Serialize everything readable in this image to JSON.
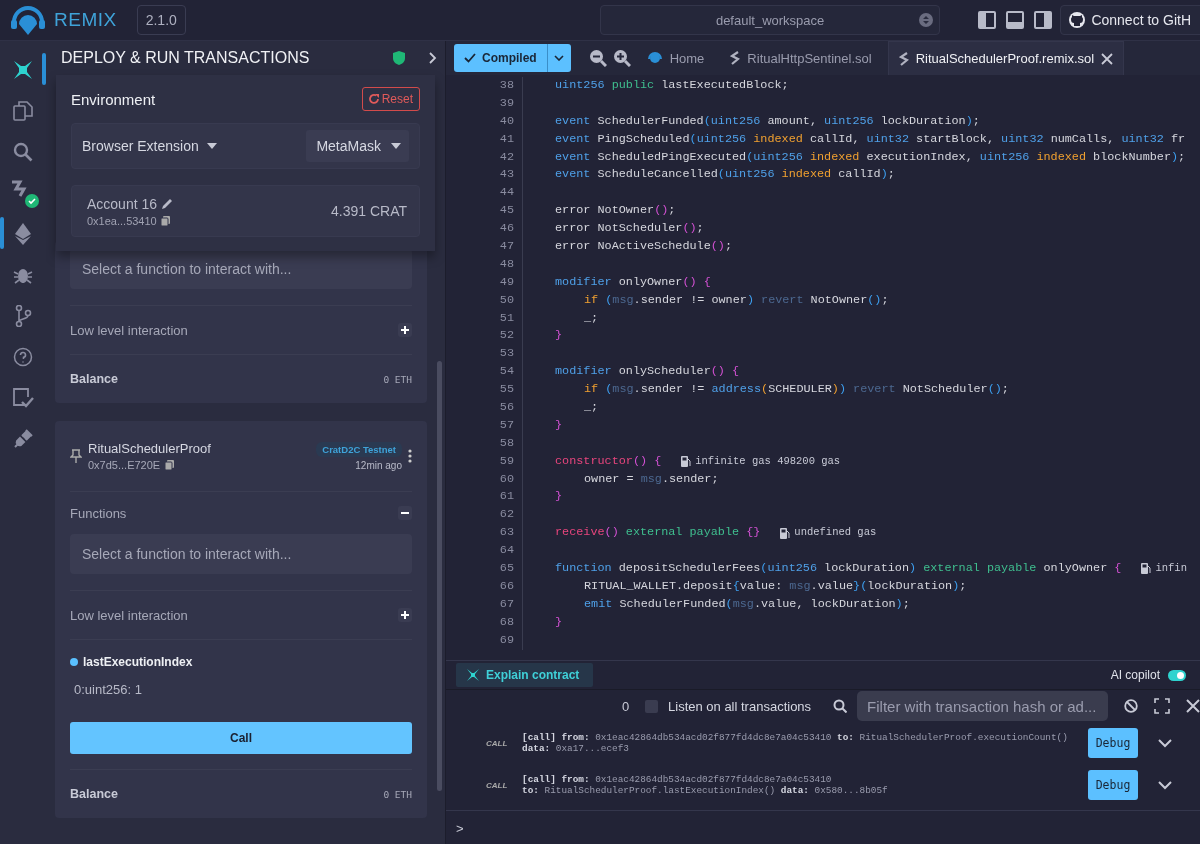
{
  "topbar": {
    "brand": "REMIX",
    "version": "2.1.0",
    "workspace": "default_workspace",
    "github_button": "Connect to GitH"
  },
  "icon_rail": [
    {
      "kind": "ai",
      "highlighted": true,
      "selected": false,
      "verified": false
    },
    {
      "kind": "files",
      "highlighted": false,
      "selected": false,
      "verified": false
    },
    {
      "kind": "search",
      "highlighted": false,
      "selected": false,
      "verified": false
    },
    {
      "kind": "compiler",
      "highlighted": false,
      "selected": false,
      "verified": true
    },
    {
      "kind": "deploy",
      "highlighted": false,
      "selected": true,
      "verified": false
    },
    {
      "kind": "debug",
      "highlighted": false,
      "selected": false,
      "verified": false
    },
    {
      "kind": "git",
      "highlighted": false,
      "selected": false,
      "verified": false
    },
    {
      "kind": "help",
      "highlighted": false,
      "selected": false,
      "verified": false
    },
    {
      "kind": "checklist",
      "highlighted": false,
      "selected": false,
      "verified": false
    },
    {
      "kind": "plugin",
      "highlighted": false,
      "selected": false,
      "verified": false
    }
  ],
  "panel": {
    "title": "DEPLOY & RUN TRANSACTIONS",
    "environment": {
      "label": "Environment",
      "reset": "Reset",
      "provider": "Browser Extension",
      "wallet": "MetaMask",
      "account": "Account 16",
      "address": "0x1ea...53410",
      "balance": "4.391 CRAT"
    },
    "contracts": [
      {
        "functions_select": "Select a function to interact with...",
        "low_level": "Low level interaction",
        "balance_label": "Balance",
        "balance": "0 ETH"
      },
      {
        "name": "RitualSchedulerProof",
        "address": "0x7d5...E720E",
        "network": "CratD2C Testnet",
        "age": "12min ago",
        "functions_label": "Functions",
        "expanded": true,
        "functions_select": "Select a function to interact with...",
        "low_level": "Low level interaction",
        "result": {
          "function": "lastExecutionIndex",
          "value": "0:uint256: 1",
          "button": "Call"
        },
        "balance_label": "Balance",
        "balance": "0 ETH"
      }
    ]
  },
  "editor": {
    "compile_button": "Compiled",
    "tabs": [
      {
        "label": "Home",
        "kind": "home",
        "selected": false
      },
      {
        "label": "RitualHttpSentinel.sol",
        "kind": "file",
        "selected": false
      },
      {
        "label": "RitualSchedulerProof.remix.sol",
        "kind": "file",
        "selected": true
      }
    ],
    "lines": [
      {
        "number": "38",
        "indented": false,
        "tokens": [
          {
            "text": "uint256",
            "kind": "kw"
          },
          {
            "text": " public",
            "kind": "mod"
          },
          {
            "text": " lastExecutedBlock;",
            "kind": "plain"
          }
        ]
      },
      {
        "number": "39"
      },
      {
        "number": "40",
        "indented": false,
        "tokens": [
          {
            "text": "event",
            "kind": "kw"
          },
          {
            "text": " SchedulerFunded",
            "kind": "plain"
          },
          {
            "text": "(",
            "kind": "paren"
          },
          {
            "text": "uint256",
            "kind": "kw"
          },
          {
            "text": " amount, ",
            "kind": "plain"
          },
          {
            "text": "uint256",
            "kind": "kw"
          },
          {
            "text": " lockDuration",
            "kind": "plain"
          },
          {
            "text": ")",
            "kind": "paren"
          },
          {
            "text": ";",
            "kind": "plain"
          }
        ]
      },
      {
        "number": "41",
        "indented": false,
        "tokens": [
          {
            "text": "event",
            "kind": "kw"
          },
          {
            "text": " PingScheduled",
            "kind": "plain"
          },
          {
            "text": "(",
            "kind": "paren"
          },
          {
            "text": "uint256",
            "kind": "kw"
          },
          {
            "text": " indexed",
            "kind": "idx"
          },
          {
            "text": " callId, ",
            "kind": "plain"
          },
          {
            "text": "uint32",
            "kind": "kw"
          },
          {
            "text": " startBlock, ",
            "kind": "plain"
          },
          {
            "text": "uint32",
            "kind": "kw"
          },
          {
            "text": " numCalls, ",
            "kind": "plain"
          },
          {
            "text": "uint32",
            "kind": "kw"
          },
          {
            "text": " fr",
            "kind": "plain"
          }
        ]
      },
      {
        "number": "42",
        "indented": false,
        "tokens": [
          {
            "text": "event",
            "kind": "kw"
          },
          {
            "text": " ScheduledPingExecuted",
            "kind": "plain"
          },
          {
            "text": "(",
            "kind": "paren"
          },
          {
            "text": "uint256",
            "kind": "kw"
          },
          {
            "text": " indexed",
            "kind": "idx"
          },
          {
            "text": " executionIndex, ",
            "kind": "plain"
          },
          {
            "text": "uint256",
            "kind": "kw"
          },
          {
            "text": " indexed",
            "kind": "idx"
          },
          {
            "text": " blockNumber",
            "kind": "plain"
          },
          {
            "text": ")",
            "kind": "paren"
          },
          {
            "text": ";",
            "kind": "plain"
          }
        ]
      },
      {
        "number": "43",
        "indented": false,
        "tokens": [
          {
            "text": "event",
            "kind": "kw"
          },
          {
            "text": " ScheduleCancelled",
            "kind": "plain"
          },
          {
            "text": "(",
            "kind": "paren"
          },
          {
            "text": "uint256",
            "kind": "kw"
          },
          {
            "text": " indexed",
            "kind": "idx"
          },
          {
            "text": " callId",
            "kind": "plain"
          },
          {
            "text": ")",
            "kind": "paren"
          },
          {
            "text": ";",
            "kind": "plain"
          }
        ]
      },
      {
        "number": "44"
      },
      {
        "number": "45",
        "indented": false,
        "tokens": [
          {
            "text": "error NotOwner",
            "kind": "plain"
          },
          {
            "text": "()",
            "kind": "brace"
          },
          {
            "text": ";",
            "kind": "plain"
          }
        ]
      },
      {
        "number": "46",
        "indented": false,
        "tokens": [
          {
            "text": "error NotScheduler",
            "kind": "plain"
          },
          {
            "text": "()",
            "kind": "brace"
          },
          {
            "text": ";",
            "kind": "plain"
          }
        ]
      },
      {
        "number": "47",
        "indented": false,
        "tokens": [
          {
            "text": "error NoActiveSchedule",
            "kind": "plain"
          },
          {
            "text": "()",
            "kind": "brace"
          },
          {
            "text": ";",
            "kind": "plain"
          }
        ]
      },
      {
        "number": "48"
      },
      {
        "number": "49",
        "indented": false,
        "tokens": [
          {
            "text": "modifier",
            "kind": "kw"
          },
          {
            "text": " onlyOwner",
            "kind": "plain"
          },
          {
            "text": "()",
            "kind": "brace"
          },
          {
            "text": " {",
            "kind": "brace"
          }
        ]
      },
      {
        "number": "50",
        "indented": true,
        "tokens": [
          {
            "text": "if",
            "kind": "idx"
          },
          {
            "text": " (",
            "kind": "paren"
          },
          {
            "text": "msg",
            "kind": "dim"
          },
          {
            "text": ".sender != owner",
            "kind": "plain"
          },
          {
            "text": ")",
            "kind": "paren"
          },
          {
            "text": " revert",
            "kind": "dim"
          },
          {
            "text": " NotOwner",
            "kind": "plain"
          },
          {
            "text": "()",
            "kind": "paren"
          },
          {
            "text": ";",
            "kind": "plain"
          }
        ]
      },
      {
        "number": "51",
        "indented": true,
        "tokens": [
          {
            "text": "_;",
            "kind": "plain"
          }
        ]
      },
      {
        "number": "52",
        "indented": false,
        "tokens": [
          {
            "text": "}",
            "kind": "brace"
          }
        ]
      },
      {
        "number": "53"
      },
      {
        "number": "54",
        "indented": false,
        "tokens": [
          {
            "text": "modifier",
            "kind": "kw"
          },
          {
            "text": " onlyScheduler",
            "kind": "plain"
          },
          {
            "text": "()",
            "kind": "brace"
          },
          {
            "text": " {",
            "kind": "brace"
          }
        ]
      },
      {
        "number": "55",
        "indented": true,
        "tokens": [
          {
            "text": "if",
            "kind": "idx"
          },
          {
            "text": " (",
            "kind": "paren"
          },
          {
            "text": "msg",
            "kind": "dim"
          },
          {
            "text": ".sender != ",
            "kind": "plain"
          },
          {
            "text": "address",
            "kind": "kw"
          },
          {
            "text": "(",
            "kind": "idx"
          },
          {
            "text": "SCHEDULER",
            "kind": "plain"
          },
          {
            "text": ")",
            "kind": "idx"
          },
          {
            "text": ")",
            "kind": "paren"
          },
          {
            "text": " revert",
            "kind": "dim"
          },
          {
            "text": " NotScheduler",
            "kind": "plain"
          },
          {
            "text": "()",
            "kind": "paren"
          },
          {
            "text": ";",
            "kind": "plain"
          }
        ]
      },
      {
        "number": "56",
        "indented": true,
        "tokens": [
          {
            "text": "_;",
            "kind": "plain"
          }
        ]
      },
      {
        "number": "57",
        "indented": false,
        "tokens": [
          {
            "text": "}",
            "kind": "brace"
          }
        ]
      },
      {
        "number": "58"
      },
      {
        "number": "59",
        "indented": false,
        "tokens": [
          {
            "text": "constructor",
            "kind": "special"
          },
          {
            "text": "()",
            "kind": "brace"
          },
          {
            "text": " {",
            "kind": "brace"
          }
        ],
        "gas": "infinite gas 498200 gas"
      },
      {
        "number": "60",
        "indented": true,
        "tokens": [
          {
            "text": "owner = ",
            "kind": "plain"
          },
          {
            "text": "msg",
            "kind": "dim"
          },
          {
            "text": ".sender;",
            "kind": "plain"
          }
        ]
      },
      {
        "number": "61",
        "indented": false,
        "tokens": [
          {
            "text": "}",
            "kind": "brace"
          }
        ]
      },
      {
        "number": "62"
      },
      {
        "number": "63",
        "indented": false,
        "tokens": [
          {
            "text": "receive",
            "kind": "special"
          },
          {
            "text": "()",
            "kind": "brace"
          },
          {
            "text": " external payable",
            "kind": "mod"
          },
          {
            "text": " {}",
            "kind": "brace"
          }
        ],
        "gas": "undefined gas"
      },
      {
        "number": "64"
      },
      {
        "number": "65",
        "indented": false,
        "tokens": [
          {
            "text": "function",
            "kind": "kw"
          },
          {
            "text": " depositSchedulerFees",
            "kind": "plain"
          },
          {
            "text": "(",
            "kind": "paren"
          },
          {
            "text": "uint256",
            "kind": "kw"
          },
          {
            "text": " lockDuration",
            "kind": "plain"
          },
          {
            "text": ")",
            "kind": "paren"
          },
          {
            "text": " external payable",
            "kind": "mod"
          },
          {
            "text": " onlyOwner ",
            "kind": "plain"
          },
          {
            "text": "{",
            "kind": "brace"
          }
        ],
        "gas": "infin"
      },
      {
        "number": "66",
        "indented": true,
        "tokens": [
          {
            "text": "RITUAL_WALLET.deposit",
            "kind": "plain"
          },
          {
            "text": "{",
            "kind": "paren"
          },
          {
            "text": "value: ",
            "kind": "plain"
          },
          {
            "text": "msg",
            "kind": "dim"
          },
          {
            "text": ".value",
            "kind": "plain"
          },
          {
            "text": "}",
            "kind": "paren"
          },
          {
            "text": "(",
            "kind": "paren"
          },
          {
            "text": "lockDuration",
            "kind": "plain"
          },
          {
            "text": ")",
            "kind": "paren"
          },
          {
            "text": ";",
            "kind": "plain"
          }
        ]
      },
      {
        "number": "67",
        "indented": true,
        "tokens": [
          {
            "text": "emit",
            "kind": "kw"
          },
          {
            "text": " SchedulerFunded",
            "kind": "plain"
          },
          {
            "text": "(",
            "kind": "paren"
          },
          {
            "text": "msg",
            "kind": "dim"
          },
          {
            "text": ".value, lockDuration",
            "kind": "plain"
          },
          {
            "text": ")",
            "kind": "paren"
          },
          {
            "text": ";",
            "kind": "plain"
          }
        ]
      },
      {
        "number": "68",
        "indented": false,
        "tokens": [
          {
            "text": "}",
            "kind": "brace"
          }
        ]
      },
      {
        "number": "69"
      }
    ]
  },
  "ai_bar": {
    "explain": "Explain contract",
    "copilot": "AI copilot",
    "copilot_on": true
  },
  "terminal": {
    "count": "0",
    "listen": "Listen on all transactions",
    "listen_checked": false,
    "filter_placeholder": "Filter with transaction hash or ad...",
    "entries": [
      {
        "tag": "CALL",
        "lines": [
          "**[call]** **from:** 0x1eac42864db534acd02f877fd4dc8e7a04c53410 **to:** RitualSchedulerProof.executionCount()",
          "**data:** 0xa17...ecef3"
        ],
        "button": "Debug"
      },
      {
        "tag": "CALL",
        "lines": [
          "**[call]** **from:** 0x1eac42864db534acd02f877fd4dc8e7a04c53410",
          "**to:** RitualSchedulerProof.lastExecutionIndex() **data:** 0x580...8b05f"
        ],
        "button": "Debug"
      }
    ],
    "prompt": ">"
  }
}
